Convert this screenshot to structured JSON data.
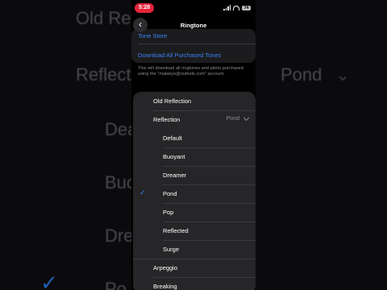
{
  "status": {
    "time": "5:28",
    "battery": "74"
  },
  "nav": {
    "title": "Ringtone",
    "back_icon": "chevron-left-icon"
  },
  "store": {
    "tone_store": "Tone Store",
    "download_all": "Download All Purchased Tones",
    "note": "This will download all ringtones and alerts purchased using the \"malakyo@outlook.com\" account."
  },
  "menu": {
    "old_reflection": "Old Reflection",
    "reflection": {
      "label": "Reflection",
      "value": "Pond"
    },
    "options": [
      "Default",
      "Buoyant",
      "Dreamer",
      "Pond",
      "Pop",
      "Reflected",
      "Surge"
    ],
    "selected": "Pond",
    "after": [
      "Arpeggio",
      "Breaking"
    ]
  },
  "background": {
    "texts": [
      "Old Refle",
      "Reflecti",
      "Pond",
      "Dea",
      "Buo",
      "Dre",
      "Po"
    ]
  }
}
